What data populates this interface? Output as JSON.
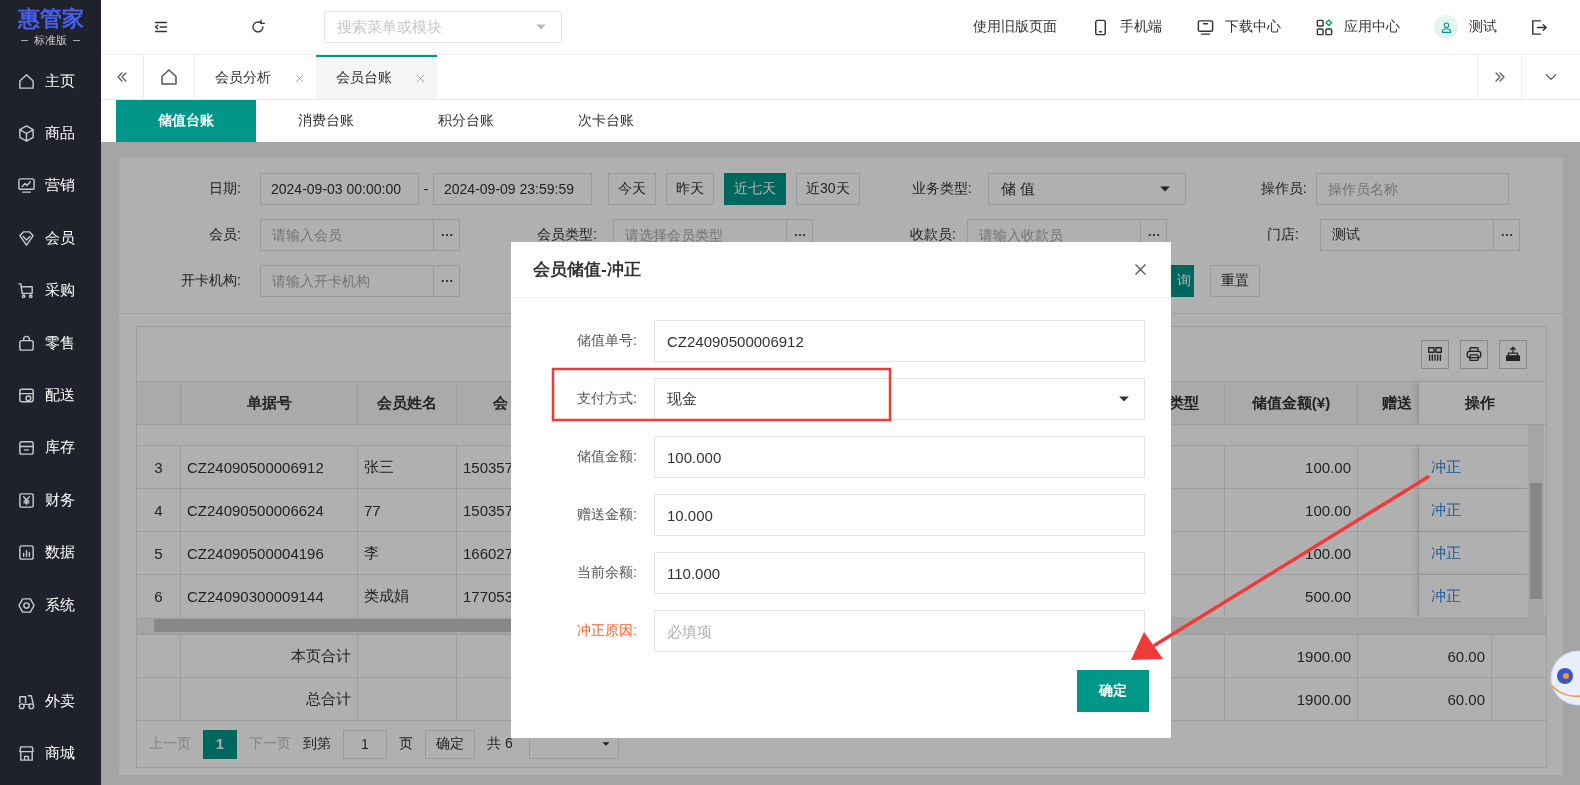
{
  "sidebar": {
    "logo": "惠管家",
    "edition": "标准版",
    "items": [
      "主页",
      "商品",
      "营销",
      "会员",
      "采购",
      "零售",
      "配送",
      "库存",
      "财务",
      "数据",
      "系统"
    ],
    "bottom_items": [
      "外卖",
      "商城"
    ]
  },
  "header": {
    "search": {
      "placeholder": "搜索菜单或模块"
    },
    "links": [
      "使用旧版页面",
      "手机端",
      "下载中心",
      "应用中心"
    ],
    "user": "测试"
  },
  "page_tabs": [
    {
      "label": "会员分析",
      "selected": false
    },
    {
      "label": "会员台账",
      "selected": true
    }
  ],
  "sub_tabs": [
    {
      "label": "储值台账",
      "selected": true
    },
    {
      "label": "消费台账",
      "selected": false
    },
    {
      "label": "积分台账",
      "selected": false
    },
    {
      "label": "次卡台账",
      "selected": false
    }
  ],
  "filters": {
    "date": {
      "label": "日期:",
      "start": "2024-09-03 00:00:00",
      "separator": "-",
      "end": "2024-09-09 23:59:59"
    },
    "quick_ranges": [
      {
        "label": "今天",
        "selected": false
      },
      {
        "label": "昨天",
        "selected": false
      },
      {
        "label": "近七天",
        "selected": true
      },
      {
        "label": "近30天",
        "selected": false
      }
    ],
    "business_type": {
      "label": "业务类型:",
      "value": "储 值"
    },
    "operator": {
      "label": "操作员:",
      "placeholder": "操作员名称"
    },
    "member": {
      "label": "会员:",
      "placeholder": "请输入会员"
    },
    "member_type": {
      "label": "会员类型:",
      "placeholder": "请选择会员类型"
    },
    "cashier": {
      "label": "收款员:",
      "placeholder": "请输入收款员"
    },
    "store": {
      "label": "门店:",
      "value": "测试"
    },
    "card_org": {
      "label": "开卡机构:",
      "placeholder": "请输入开卡机构"
    },
    "query_button": "询",
    "reset_button": "重置"
  },
  "table": {
    "columns": [
      "单据号",
      "会员姓名",
      "会",
      "类型",
      "储值金额(¥)",
      "赠送",
      "操作"
    ],
    "rows": [
      {
        "index": "3",
        "bill_no": "CZ24090500006912",
        "member_name": "张三",
        "column_3": "150357",
        "stored_amount": "100.00",
        "action": "冲正"
      },
      {
        "index": "4",
        "bill_no": "CZ24090500006624",
        "member_name": "77",
        "column_3": "150357",
        "stored_amount": "100.00",
        "action": "冲正"
      },
      {
        "index": "5",
        "bill_no": "CZ24090500004196",
        "member_name": "李",
        "column_3": "166027",
        "stored_amount": "100.00",
        "action": "冲正"
      },
      {
        "index": "6",
        "bill_no": "CZ24090300009144",
        "member_name": "类成娟",
        "column_3": "177053",
        "stored_amount": "500.00",
        "action": "冲正"
      }
    ],
    "totals": [
      {
        "label": "本页合计",
        "stored_amount": "1900.00",
        "bonus_amount": "60.00"
      },
      {
        "label": "总合计",
        "stored_amount": "1900.00",
        "bonus_amount": "60.00"
      }
    ]
  },
  "pagination": {
    "prev": "上一页",
    "pages": [
      {
        "label": "1",
        "selected": true
      }
    ],
    "next": "下一页",
    "goto_label": "到第",
    "goto_value": "1",
    "page_unit": "页",
    "confirm": "确定",
    "total": "共 6"
  },
  "modal": {
    "title": "会员储值-冲正",
    "fields": [
      {
        "kind": "text",
        "label": "储值单号:",
        "value": "CZ24090500006912",
        "required": false
      },
      {
        "kind": "select",
        "label": "支付方式:",
        "value": "现金",
        "required": false
      },
      {
        "kind": "text",
        "label": "储值金额:",
        "value": "100.000",
        "required": false
      },
      {
        "kind": "text",
        "label": "赠送金额:",
        "value": "10.000",
        "required": false
      },
      {
        "kind": "text",
        "label": "当前余额:",
        "value": "110.000",
        "required": false
      },
      {
        "kind": "text",
        "label": "冲正原因:",
        "placeholder": "必填项",
        "required": true
      }
    ],
    "confirm": "确定"
  }
}
